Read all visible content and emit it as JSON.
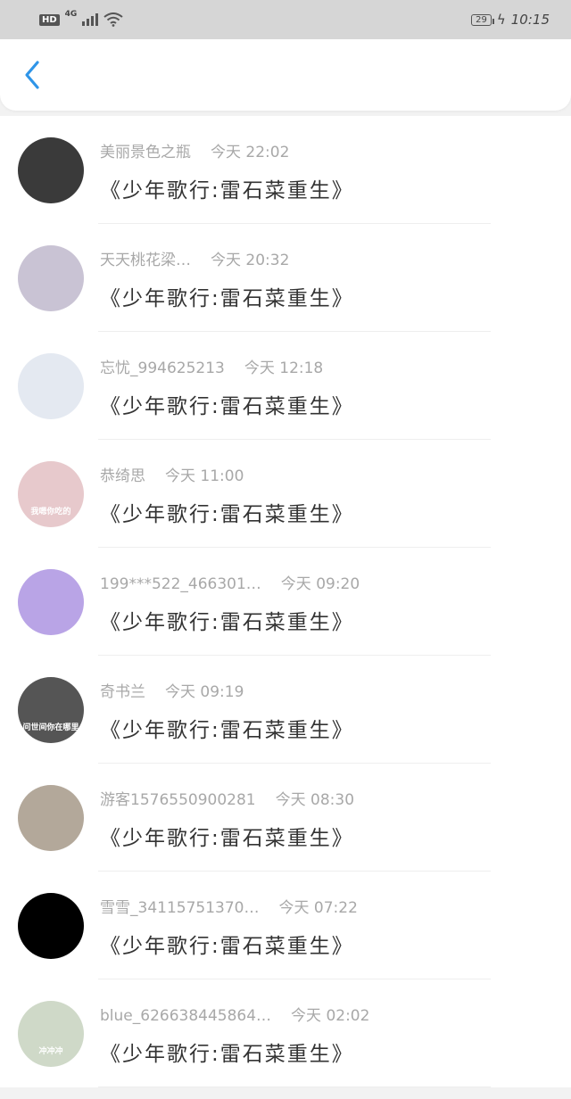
{
  "status": {
    "hd": "HD",
    "network": "4G",
    "battery": "29",
    "time": "10:15"
  },
  "nav": {
    "back_icon": "chevron-left-icon"
  },
  "items": [
    {
      "name": "美丽景色之瓶",
      "time": "今天 22:02",
      "title": "《少年歌行:雷石菜重生》",
      "avatar_color": "#3a3a3a"
    },
    {
      "name": "天天桃花梁…",
      "time": "今天 20:32",
      "title": "《少年歌行:雷石菜重生》",
      "avatar_color": "#c9c3d4"
    },
    {
      "name": "忘忧_994625213",
      "time": "今天 12:18",
      "title": "《少年歌行:雷石菜重生》",
      "avatar_color": "#e4e9f1"
    },
    {
      "name": "恭绮思",
      "time": "今天 11:00",
      "title": "《少年歌行:雷石菜重生》",
      "avatar_color": "#e7c9cc",
      "avatar_text": "我嗯你吃的"
    },
    {
      "name": "199***522_466301…",
      "time": "今天 09:20",
      "title": "《少年歌行:雷石菜重生》",
      "avatar_color": "#b9a4e6"
    },
    {
      "name": "奇书兰",
      "time": "今天 09:19",
      "title": "《少年歌行:雷石菜重生》",
      "avatar_color": "#555555",
      "avatar_text": "问世间你在哪里"
    },
    {
      "name": "游客1576550900281",
      "time": "今天 08:30",
      "title": "《少年歌行:雷石菜重生》",
      "avatar_color": "#b3a89a"
    },
    {
      "name": "雪雪_34115751370…",
      "time": "今天 07:22",
      "title": "《少年歌行:雷石菜重生》",
      "avatar_color": "#000000"
    },
    {
      "name": "blue_626638445864…",
      "time": "今天 02:02",
      "title": "《少年歌行:雷石菜重生》",
      "avatar_color": "#cfd9c8",
      "avatar_text": "冲冲冲"
    }
  ]
}
